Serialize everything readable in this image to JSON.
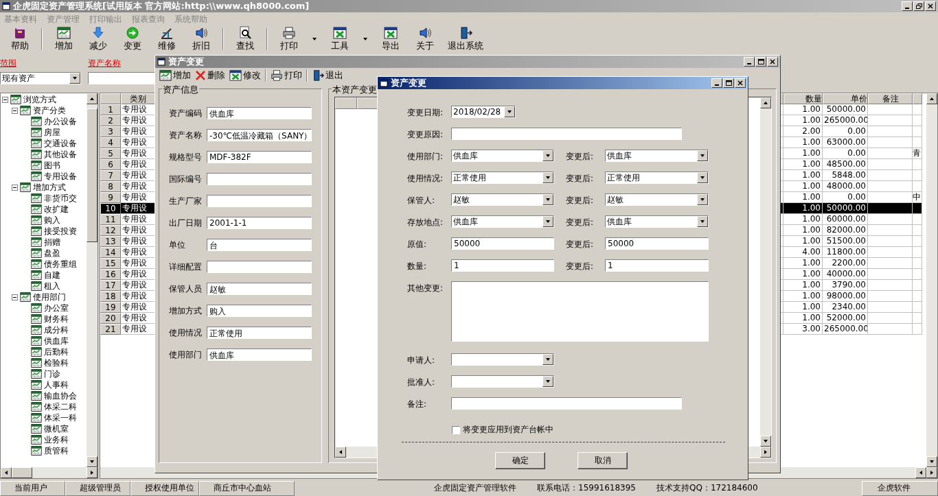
{
  "window": {
    "title": "企虎固定资产管理系统[试用版本  官方网站:http:\\\\www.qh8000.com]"
  },
  "menu": [
    "基本资料",
    "资产管理",
    "打印输出",
    "报表查询",
    "系统帮助"
  ],
  "toolbar": [
    {
      "kind": "button",
      "label": "帮助"
    },
    {
      "kind": "separator"
    },
    {
      "kind": "button",
      "label": "增加"
    },
    {
      "kind": "button",
      "label": "减少"
    },
    {
      "kind": "button",
      "label": "变更"
    },
    {
      "kind": "button",
      "label": "维修"
    },
    {
      "kind": "button",
      "label": "折旧"
    },
    {
      "kind": "separator"
    },
    {
      "kind": "button",
      "label": "查找"
    },
    {
      "kind": "separator"
    },
    {
      "kind": "dropdown",
      "label": "打印"
    },
    {
      "kind": "dropdown",
      "label": "工具"
    },
    {
      "kind": "button",
      "label": "导出"
    },
    {
      "kind": "button",
      "label": "关于"
    },
    {
      "kind": "button",
      "label": "退出系统"
    }
  ],
  "filter": {
    "scope_label": "范围",
    "scope_value": "现有资产",
    "name_label": "资产名称"
  },
  "tree": [
    {
      "label": "浏览方式",
      "expanded": true,
      "children": [
        {
          "label": "资产分类",
          "expanded": true,
          "children": [
            {
              "label": "办公设备"
            },
            {
              "label": "房屋"
            },
            {
              "label": "交通设备"
            },
            {
              "label": "其他设备"
            },
            {
              "label": "图书"
            },
            {
              "label": "专用设备"
            }
          ]
        },
        {
          "label": "增加方式",
          "expanded": true,
          "children": [
            {
              "label": "非货币交"
            },
            {
              "label": "改扩建"
            },
            {
              "label": "购入"
            },
            {
              "label": "接受投资"
            },
            {
              "label": "捐赠"
            },
            {
              "label": "盘盈"
            },
            {
              "label": "债务重组"
            },
            {
              "label": "自建"
            },
            {
              "label": "租入"
            }
          ]
        },
        {
          "label": "使用部门",
          "expanded": true,
          "children": [
            {
              "label": "办公室"
            },
            {
              "label": "财务科"
            },
            {
              "label": "成分科"
            },
            {
              "label": "供血库"
            },
            {
              "label": "后勤科"
            },
            {
              "label": "检验科"
            },
            {
              "label": "门诊"
            },
            {
              "label": "人事科"
            },
            {
              "label": "输血协会"
            },
            {
              "label": "体采二科"
            },
            {
              "label": "体采一科"
            },
            {
              "label": "微机室"
            },
            {
              "label": "业务科"
            },
            {
              "label": "质管科"
            }
          ]
        }
      ]
    }
  ],
  "asset_table": {
    "columns": [
      "类别",
      "数量",
      "单价",
      "备注"
    ],
    "rows": [
      {
        "number": "1",
        "category": "专用设",
        "quantity": "1.00",
        "price": "50000.00",
        "selected": false
      },
      {
        "number": "2",
        "category": "专用设",
        "quantity": "1.00",
        "price": "265000.00",
        "selected": false
      },
      {
        "number": "3",
        "category": "专用设",
        "quantity": "2.00",
        "price": "0.00",
        "selected": false
      },
      {
        "number": "4",
        "category": "专用设",
        "quantity": "1.00",
        "price": "63000.00",
        "selected": false
      },
      {
        "number": "5",
        "category": "专用设",
        "quantity": "1.00",
        "price": "0.00",
        "column_5": "青",
        "selected": false
      },
      {
        "number": "6",
        "category": "专用设",
        "quantity": "1.00",
        "price": "48500.00",
        "selected": false
      },
      {
        "number": "7",
        "category": "专用设",
        "quantity": "1.00",
        "price": "5848.00",
        "selected": false
      },
      {
        "number": "8",
        "category": "专用设",
        "quantity": "1.00",
        "price": "48000.00",
        "selected": false
      },
      {
        "number": "9",
        "category": "专用设",
        "quantity": "1.00",
        "price": "0.00",
        "column_5": "中",
        "selected": false
      },
      {
        "number": "10",
        "category": "专用设",
        "quantity": "1.00",
        "price": "50000.00",
        "selected": true
      },
      {
        "number": "11",
        "category": "专用设",
        "quantity": "1.00",
        "price": "60000.00",
        "selected": false
      },
      {
        "number": "12",
        "category": "专用设",
        "quantity": "1.00",
        "price": "82000.00",
        "selected": false
      },
      {
        "number": "13",
        "category": "专用设",
        "quantity": "1.00",
        "price": "51500.00",
        "selected": false
      },
      {
        "number": "14",
        "category": "专用设",
        "quantity": "4.00",
        "price": "11800.00",
        "selected": false
      },
      {
        "number": "15",
        "category": "专用设",
        "quantity": "1.00",
        "price": "2200.00",
        "selected": false
      },
      {
        "number": "16",
        "category": "专用设",
        "quantity": "1.00",
        "price": "40000.00",
        "selected": false
      },
      {
        "number": "17",
        "category": "专用设",
        "quantity": "1.00",
        "price": "3790.00",
        "selected": false
      },
      {
        "number": "18",
        "category": "专用设",
        "quantity": "1.00",
        "price": "98000.00",
        "selected": false
      },
      {
        "number": "19",
        "category": "专用设",
        "quantity": "1.00",
        "price": "2340.00",
        "selected": false
      },
      {
        "number": "20",
        "category": "专用设",
        "quantity": "1.00",
        "price": "52000.00",
        "selected": false
      },
      {
        "number": "21",
        "category": "专用设",
        "quantity": "3.00",
        "price": "265000.00",
        "selected": false
      }
    ]
  },
  "change_window": {
    "title": "资产变更",
    "toolbar": [
      "增加",
      "删除",
      "修改",
      "打印",
      "退出"
    ],
    "info_group": {
      "title": "资产信息",
      "fields": [
        {
          "label": "资产编码",
          "value": "供血库"
        },
        {
          "label": "资产名称",
          "value": "-30℃低温冷藏箱（SANY）"
        },
        {
          "label": "规格型号",
          "value": "MDF-382F"
        },
        {
          "label": "国际编号"
        },
        {
          "label": "生产厂家"
        },
        {
          "label": "出厂日期",
          "value": "2001-1-1"
        },
        {
          "label": "单位",
          "value": "台"
        },
        {
          "label": "详细配置"
        },
        {
          "label": "保管人员",
          "value": "赵敏"
        },
        {
          "label": "增加方式",
          "value": "购入"
        },
        {
          "label": "使用情况",
          "value": "正常使用"
        },
        {
          "label": "使用部门",
          "value": "供血库"
        }
      ]
    },
    "history_group": {
      "title": "本资产变更"
    }
  },
  "change_dialog": {
    "title": "资产变更",
    "date": {
      "label": "变更日期:",
      "value": "2018/02/28"
    },
    "reason": {
      "label": "变更原因:"
    },
    "pairs": [
      {
        "label": "使用部门:",
        "kind": "combo",
        "before": "供血库",
        "after_label": "变更后:",
        "after": "供血库"
      },
      {
        "label": "使用情况:",
        "kind": "combo",
        "before": "正常使用",
        "after_label": "变更后:",
        "after": "正常使用"
      },
      {
        "label": "保管人:",
        "kind": "combo",
        "before": "赵敏",
        "after_label": "变更后:",
        "after": "赵敏"
      },
      {
        "label": "存放地点:",
        "kind": "combo",
        "before": "供血库",
        "after_label": "变更后:",
        "after": "供血库"
      },
      {
        "label": "原值:",
        "kind": "text",
        "before": "50000",
        "after_label": "变更后:",
        "after": "50000"
      },
      {
        "label": "数量:",
        "kind": "text",
        "before": "1",
        "after_label": "变更后:",
        "after": "1"
      }
    ],
    "other": {
      "label": "其他变更:"
    },
    "applicant": {
      "label": "申请人:"
    },
    "approver": {
      "label": "批准人:"
    },
    "note": {
      "label": "备注:"
    },
    "apply": {
      "label": "将变更应用到资产台帐中",
      "checked": false
    },
    "buttons": [
      "确定",
      "取消"
    ]
  },
  "status_bar": [
    {
      "text": "当前用户",
      "kind": "panel"
    },
    {
      "text": "超级管理员",
      "kind": "panel"
    },
    {
      "text": "授权使用单位",
      "kind": "panel"
    },
    {
      "text": "商丘市中心血站",
      "kind": "panel"
    },
    {
      "text": "企虎固定资产管理软件",
      "kind": "plain"
    },
    {
      "text": "联系电话：15991618395",
      "kind": "plain"
    },
    {
      "text": "技术支持QQ：172184600",
      "kind": "plain"
    },
    {
      "text": "企虎软件",
      "kind": "panel"
    }
  ]
}
